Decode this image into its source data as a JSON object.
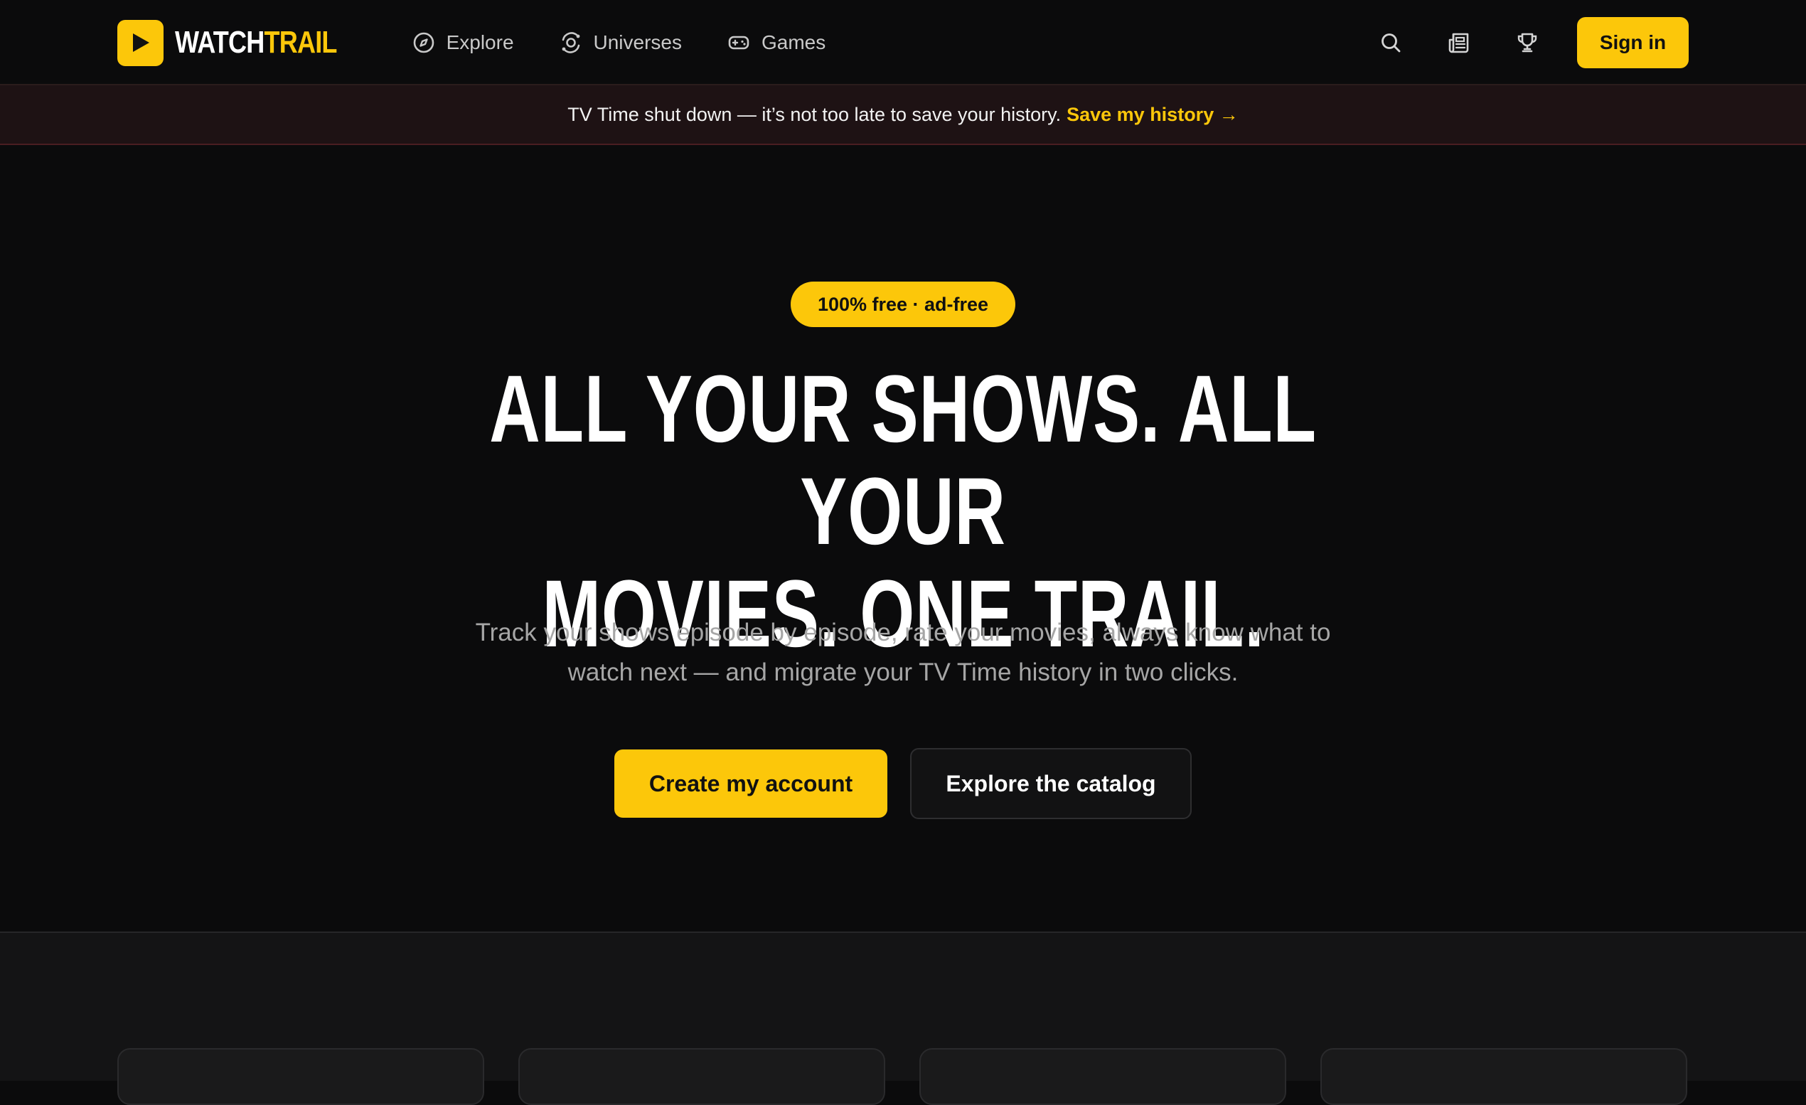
{
  "nav": {
    "logo": {
      "word1": "WATCH",
      "word2": "TRAIL"
    },
    "links": [
      {
        "label": "Explore",
        "icon": "compass-icon"
      },
      {
        "label": "Universes",
        "icon": "orbit-icon"
      },
      {
        "label": "Games",
        "icon": "gamepad-icon"
      }
    ],
    "actions": [
      "search-icon",
      "news-icon",
      "trophy-icon"
    ],
    "signin_label": "Sign in"
  },
  "banner": {
    "text": "TV Time shut down — it’s not too late to save your history.",
    "link": "Save my history →"
  },
  "hero": {
    "badge": "100% free · ad-free",
    "headline_line1": "ALL YOUR SHOWS. ALL YOUR",
    "headline_line2": "MOVIES. ONE TRAIL.",
    "subtitle_line1": "Track your shows episode by episode, rate your movies, always know what to",
    "subtitle_line2": "watch next — and migrate your TV Time history in two clicks.",
    "cta_primary": "Create my account",
    "cta_secondary": "Explore the catalog"
  },
  "colors": {
    "accent": "#fcc70a",
    "background": "#0b0b0c",
    "banner_bg": "#1e1214",
    "text_muted": "#a6a6a6"
  }
}
